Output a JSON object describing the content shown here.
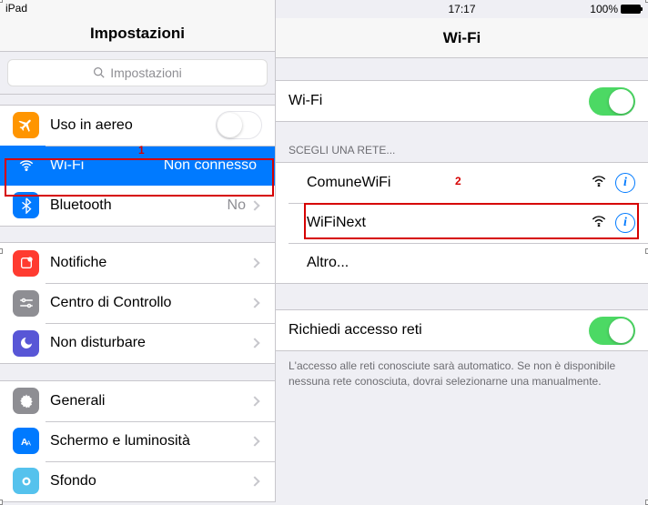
{
  "status": {
    "device": "iPad",
    "time": "17:17",
    "battery": "100%"
  },
  "sidebar": {
    "title": "Impostazioni",
    "search_placeholder": "Impostazioni",
    "groups": [
      {
        "rows": [
          {
            "icon": "airplane",
            "label": "Uso in aereo",
            "accessory": "toggle-off"
          },
          {
            "icon": "wifi",
            "label": "Wi-Fi",
            "detail": "Non connesso",
            "selected": true
          },
          {
            "icon": "bluetooth",
            "label": "Bluetooth",
            "detail": "No"
          }
        ]
      },
      {
        "rows": [
          {
            "icon": "notif",
            "label": "Notifiche"
          },
          {
            "icon": "control",
            "label": "Centro di Controllo"
          },
          {
            "icon": "dnd",
            "label": "Non disturbare"
          }
        ]
      },
      {
        "rows": [
          {
            "icon": "general",
            "label": "Generali"
          },
          {
            "icon": "display",
            "label": "Schermo e luminosità"
          },
          {
            "icon": "bg",
            "label": "Sfondo"
          }
        ]
      }
    ]
  },
  "main": {
    "title": "Wi-Fi",
    "wifi_toggle_label": "Wi-Fi",
    "networks_header": "SCEGLI UNA RETE...",
    "networks": [
      {
        "name": "ComuneWiFi"
      },
      {
        "name": "WiFiNext"
      }
    ],
    "other_label": "Altro...",
    "ask_label": "Richiedi accesso reti",
    "ask_footer": "L'accesso alle reti conosciute sarà automatico. Se non è disponibile nessuna rete conosciuta, dovrai selezionarne una manualmente."
  },
  "annotations": {
    "a1": "1",
    "a2": "2"
  }
}
